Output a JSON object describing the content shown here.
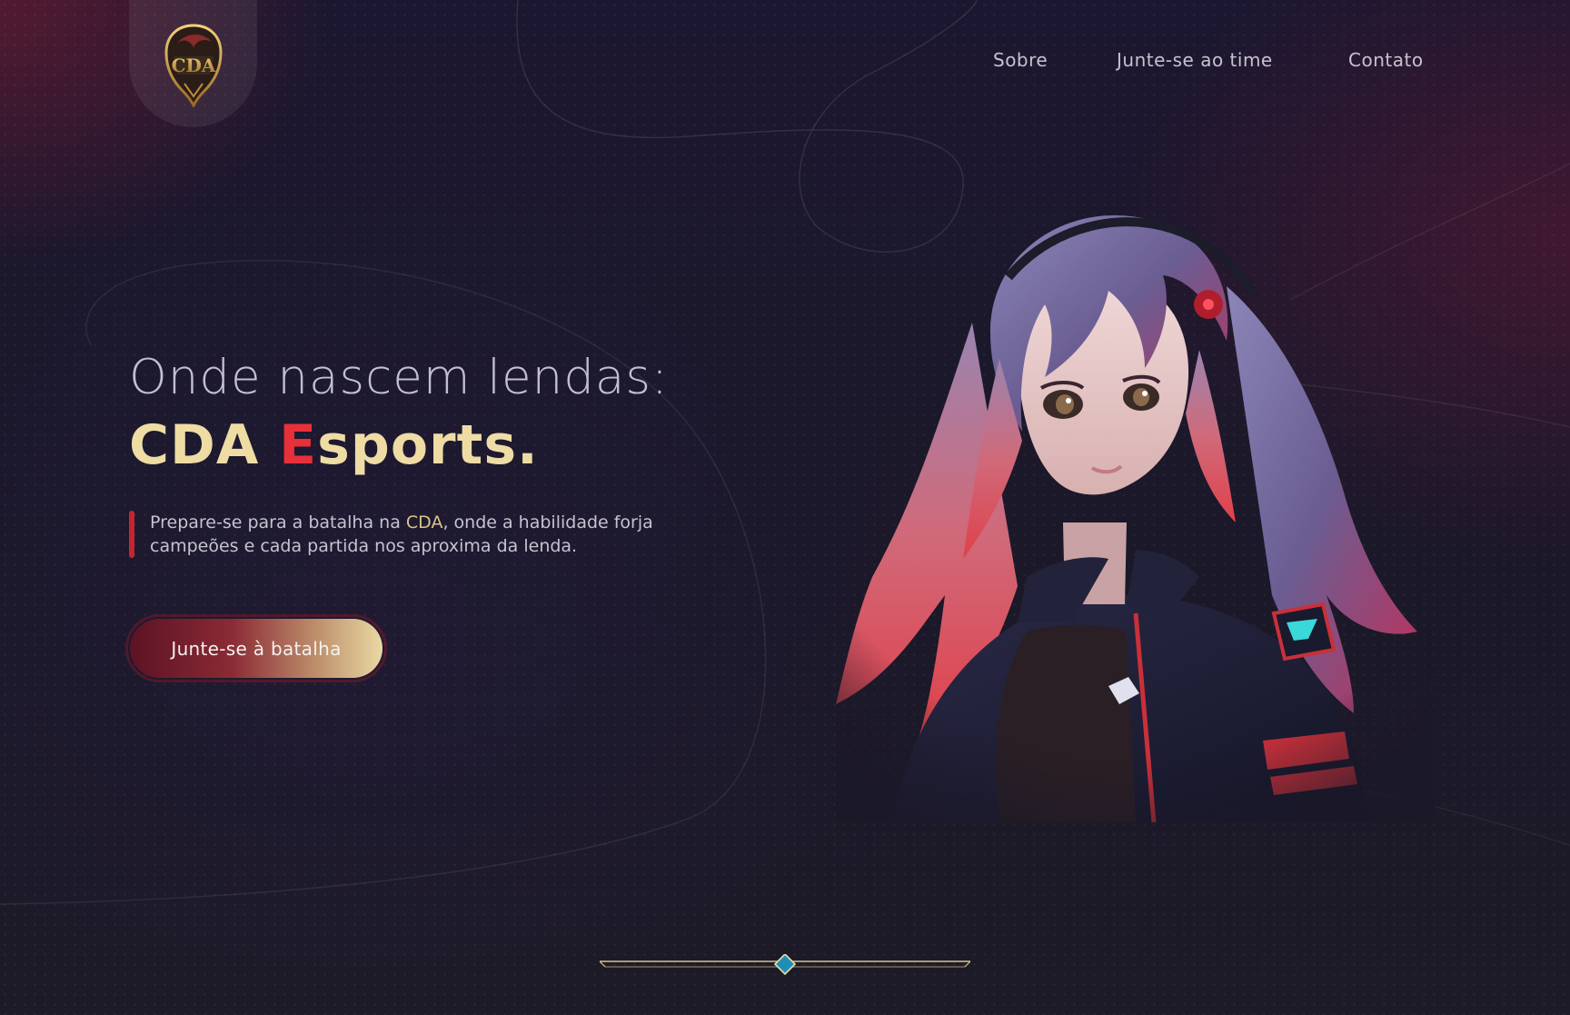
{
  "logo": {
    "text": "CDA",
    "icon": "dragon-emblem-icon"
  },
  "nav": {
    "items": [
      {
        "label": "Sobre"
      },
      {
        "label": "Junte-se ao time"
      },
      {
        "label": "Contato"
      }
    ]
  },
  "hero": {
    "headline": "Onde nascem lendas:",
    "brand_part1": "CDA ",
    "brand_accent": "E",
    "brand_part2": "sports.",
    "desc_part1": "Prepare-se para a batalha na ",
    "desc_highlight": "CDA",
    "desc_part2": ", onde a habilidade forja campeões e cada partida nos aproxima da lenda.",
    "cta_label": "Junte-se à batalha",
    "illustration": "anime-gamer-girl-illustration"
  },
  "slider": {
    "icon": "diamond-indicator-icon"
  },
  "colors": {
    "background": "#1a1727",
    "gold": "#eedca4",
    "accent_red": "#e8303a",
    "text": "#c7c2cf"
  }
}
